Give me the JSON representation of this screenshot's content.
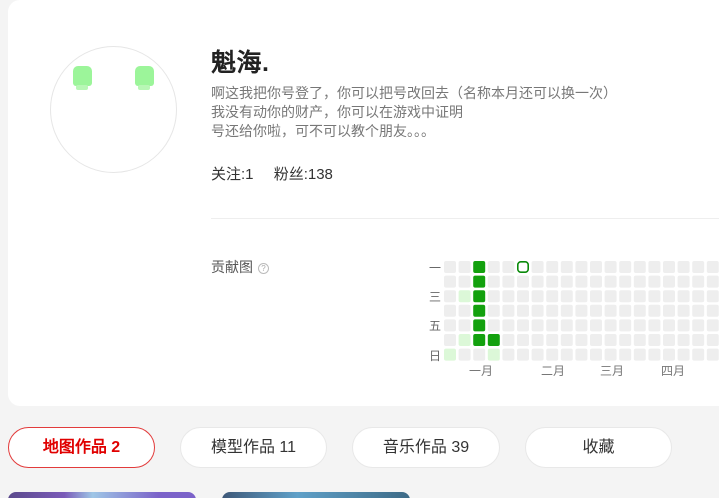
{
  "profile": {
    "nickname": "魁海.",
    "bio_lines": [
      "啊这我把你号登了，你可以把号改回去（名称本月还可以换一次）",
      "我没有动你的财产，你可以在游戏中证明",
      "号还给你啦，可不可以教个朋友。。。"
    ],
    "stats": {
      "following": "关注:1",
      "followers": "粉丝:138"
    }
  },
  "contribution": {
    "label": "贡献图",
    "help_icon": "question-circle-icon",
    "weekday_labels": [
      "一",
      "三",
      "五",
      "日"
    ],
    "month_labels": [
      "一月",
      "二月",
      "三月",
      "四月"
    ],
    "colors": {
      "empty": "#eeeeee",
      "light": "#dcf8d8",
      "dark": "#13a10e",
      "today_outline": "#0a8a0a"
    },
    "weeks": 19,
    "days_per_week": 7,
    "light_cells": [
      [
        0,
        6
      ],
      [
        1,
        2
      ],
      [
        1,
        5
      ],
      [
        3,
        5
      ],
      [
        3,
        6
      ]
    ],
    "dark_cells": [
      [
        2,
        0
      ],
      [
        2,
        1
      ],
      [
        2,
        2
      ],
      [
        2,
        3
      ],
      [
        2,
        4
      ],
      [
        2,
        5
      ],
      [
        3,
        5
      ]
    ],
    "today_cell": [
      5,
      0
    ]
  },
  "tabs": [
    {
      "label": "地图作品 2",
      "active": true
    },
    {
      "label": "模型作品 11",
      "active": false
    },
    {
      "label": "音乐作品 39",
      "active": false
    },
    {
      "label": "收藏",
      "active": false
    }
  ],
  "colors": {
    "accent": "#e00000",
    "avatar_green": "#9cf59a"
  }
}
